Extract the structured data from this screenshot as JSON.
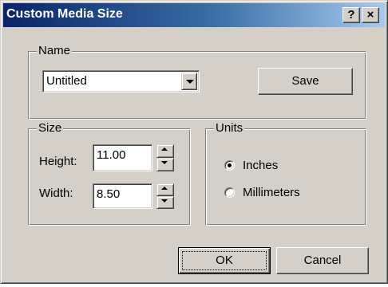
{
  "window": {
    "title": "Custom Media Size",
    "help_button": "?",
    "close_button": "×"
  },
  "name_group": {
    "label": "Name",
    "selected_name": "Untitled",
    "save_label": "Save"
  },
  "size_group": {
    "label": "Size",
    "height_label": "Height:",
    "height_value": "11.00",
    "width_label": "Width:",
    "width_value": "8.50"
  },
  "units_group": {
    "label": "Units",
    "options": [
      {
        "label": "Inches",
        "selected": true
      },
      {
        "label": "Millimeters",
        "selected": false
      }
    ]
  },
  "footer": {
    "ok_label": "OK",
    "cancel_label": "Cancel"
  }
}
